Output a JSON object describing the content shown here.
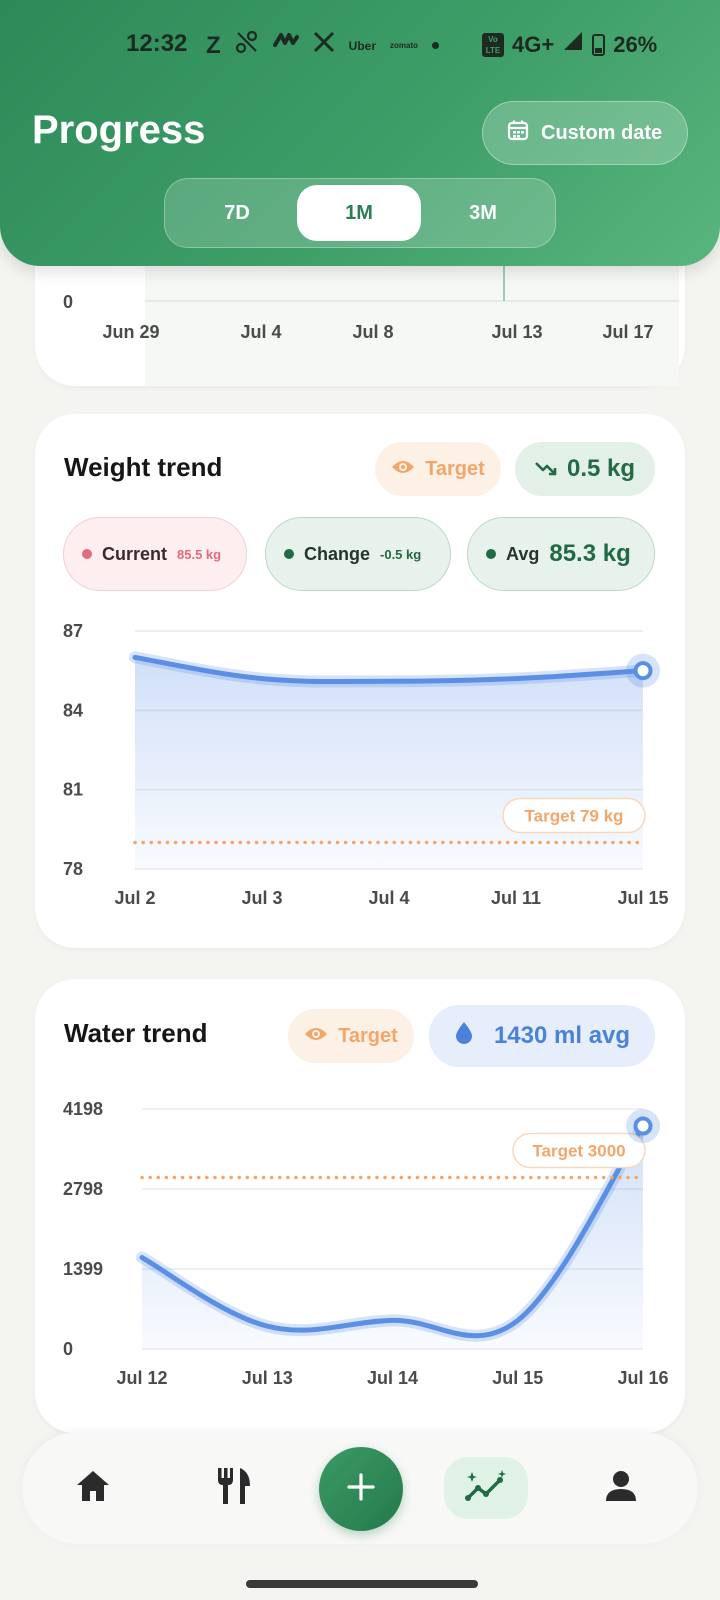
{
  "status_bar": {
    "time": "12:32",
    "apps": [
      "Z",
      "Uber",
      "zomato"
    ],
    "network": "4G+",
    "volte": "Vo LTE",
    "battery": "26%"
  },
  "header": {
    "title": "Progress",
    "custom_date_label": "Custom date",
    "tabs": [
      {
        "label": "7D",
        "active": false
      },
      {
        "label": "1M",
        "active": true
      },
      {
        "label": "3M",
        "active": false
      }
    ]
  },
  "top_card": {
    "y_tick": "0",
    "x_ticks": [
      "Jun 29",
      "Jul 4",
      "Jul 8",
      "Jul 13",
      "Jul 17"
    ]
  },
  "weight_card": {
    "title": "Weight trend",
    "target_pill": "Target",
    "change_pill": "0.5 kg",
    "chips": [
      {
        "label": "Current",
        "value": "85.5 kg",
        "color": "#e46b7c"
      },
      {
        "label": "Change",
        "value": "-0.5 kg",
        "color": "#1f6b43"
      },
      {
        "label": "Avg",
        "value": "85.3 kg",
        "color": "#1f6b43"
      }
    ],
    "target_label": "Target 79 kg"
  },
  "water_card": {
    "title": "Water trend",
    "target_pill": "Target",
    "avg_pill": "1430 ml avg",
    "target_label": "Target 3000"
  },
  "chart_data": [
    {
      "type": "line",
      "title": "Weight trend",
      "x": [
        "Jul 2",
        "Jul 3",
        "Jul 4",
        "Jul 11",
        "Jul 15"
      ],
      "series": [
        {
          "values": [
            86.0,
            85.2,
            85.1,
            85.2,
            85.5
          ]
        }
      ],
      "yticks": [
        87,
        84,
        81,
        78
      ],
      "ylim": [
        78,
        87
      ],
      "target": 79,
      "line_color": "#5b8fe6",
      "target_color": "#f2a66a"
    },
    {
      "type": "line",
      "title": "Water trend",
      "x": [
        "Jul 12",
        "Jul 13",
        "Jul 14",
        "Jul 15",
        "Jul 16"
      ],
      "series": [
        {
          "values": [
            1600,
            400,
            500,
            500,
            3900
          ]
        }
      ],
      "yticks": [
        4198,
        2798,
        1399,
        0
      ],
      "ylim": [
        0,
        4198
      ],
      "target": 3000,
      "line_color": "#5b8fe6",
      "target_color": "#f2a66a"
    }
  ],
  "bottom_nav": {
    "items": [
      "home-icon",
      "fork-knife-icon",
      "plus-icon",
      "trend-icon",
      "profile-icon"
    ],
    "active": "trend-icon"
  }
}
